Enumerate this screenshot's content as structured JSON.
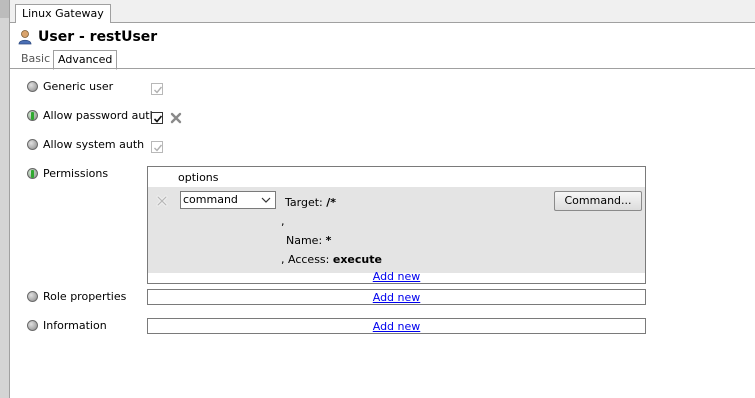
{
  "window_tab": "Linux Gateway",
  "page_title": "User - restUser",
  "tabs": {
    "basic": "Basic",
    "advanced": "Advanced"
  },
  "fields": {
    "generic_user": "Generic user",
    "allow_password_auth": "Allow password auth",
    "allow_system_auth": "Allow system auth",
    "permissions": "Permissions",
    "role_properties": "Role properties",
    "information": "Information"
  },
  "permissions": {
    "options_header": "options",
    "row": {
      "type_selected": "command",
      "target_label": "Target:",
      "target_value": "/*",
      "sep1": ",",
      "name_label": "Name:",
      "name_value": "*",
      "access_label": ", Access:",
      "access_value": "execute",
      "command_button": "Command..."
    },
    "add_new": "Add new"
  },
  "role_properties_add_new": "Add new",
  "information_add_new": "Add new",
  "colors": {
    "link": "#0000ee",
    "panel_row_bg": "#e4e4e4",
    "active_green": "#2fa82f"
  },
  "icons": [
    "user-icon",
    "status-bullet-icon",
    "checkbox-icon",
    "delete-x-icon",
    "chevron-down-icon"
  ]
}
